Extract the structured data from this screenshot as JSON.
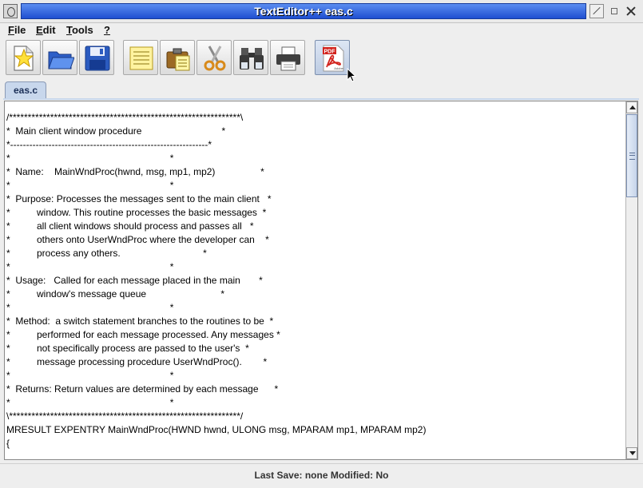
{
  "window": {
    "title": "TextEditor++ eas.c"
  },
  "menu": [
    {
      "label": "File",
      "mnemonic": "F",
      "rest": "ile"
    },
    {
      "label": "Edit",
      "mnemonic": "E",
      "rest": "dit"
    },
    {
      "label": "Tools",
      "mnemonic": "T",
      "rest": "ools"
    },
    {
      "label": "?",
      "mnemonic": "?",
      "rest": ""
    }
  ],
  "toolbar": [
    {
      "name": "new-file",
      "icon": "star-document-icon"
    },
    {
      "name": "open-folder",
      "icon": "folder-icon"
    },
    {
      "name": "save",
      "icon": "floppy-disk-icon"
    },
    {
      "name": "notes",
      "icon": "notepad-icon"
    },
    {
      "name": "paste",
      "icon": "clipboard-icon"
    },
    {
      "name": "cut",
      "icon": "scissors-icon"
    },
    {
      "name": "find",
      "icon": "binoculars-icon"
    },
    {
      "name": "print",
      "icon": "printer-icon"
    },
    {
      "name": "export-pdf",
      "icon": "pdf-icon",
      "label": "PDF",
      "sublabel": "Adobe"
    }
  ],
  "tabs": [
    {
      "label": "eas.c",
      "active": true
    }
  ],
  "editor": {
    "lines": [
      "/**************************************************************\\",
      "*  Main client window procedure                              *",
      "*--------------------------------------------------------------*",
      "*                                                            *",
      "*  Name:    MainWndProc(hwnd, msg, mp1, mp2)                 *",
      "*                                                            *",
      "*  Purpose: Processes the messages sent to the main client   *",
      "*          window. This routine processes the basic messages  *",
      "*          all client windows should process and passes all   *",
      "*          others onto UserWndProc where the developer can    *",
      "*          process any others.                               *",
      "*                                                            *",
      "*  Usage:   Called for each message placed in the main       *",
      "*          window's message queue                            *",
      "*                                                            *",
      "*  Method:  a switch statement branches to the routines to be  *",
      "*          performed for each message processed. Any messages *",
      "*          not specifically process are passed to the user's  *",
      "*          message processing procedure UserWndProc().        *",
      "*                                                            *",
      "*  Returns: Return values are determined by each message      *",
      "*                                                            *",
      "\\**************************************************************/",
      "MRESULT EXPENTRY MainWndProc(HWND hwnd, ULONG msg, MPARAM mp1, MPARAM mp2)",
      "{"
    ]
  },
  "status": {
    "text": "Last Save: none Modified: No"
  },
  "colors": {
    "title_gradient_top": "#5b8df0",
    "title_gradient_bottom": "#1f4fd1",
    "tab_active": "#c8d7ec",
    "pdf_red": "#d2231d"
  }
}
